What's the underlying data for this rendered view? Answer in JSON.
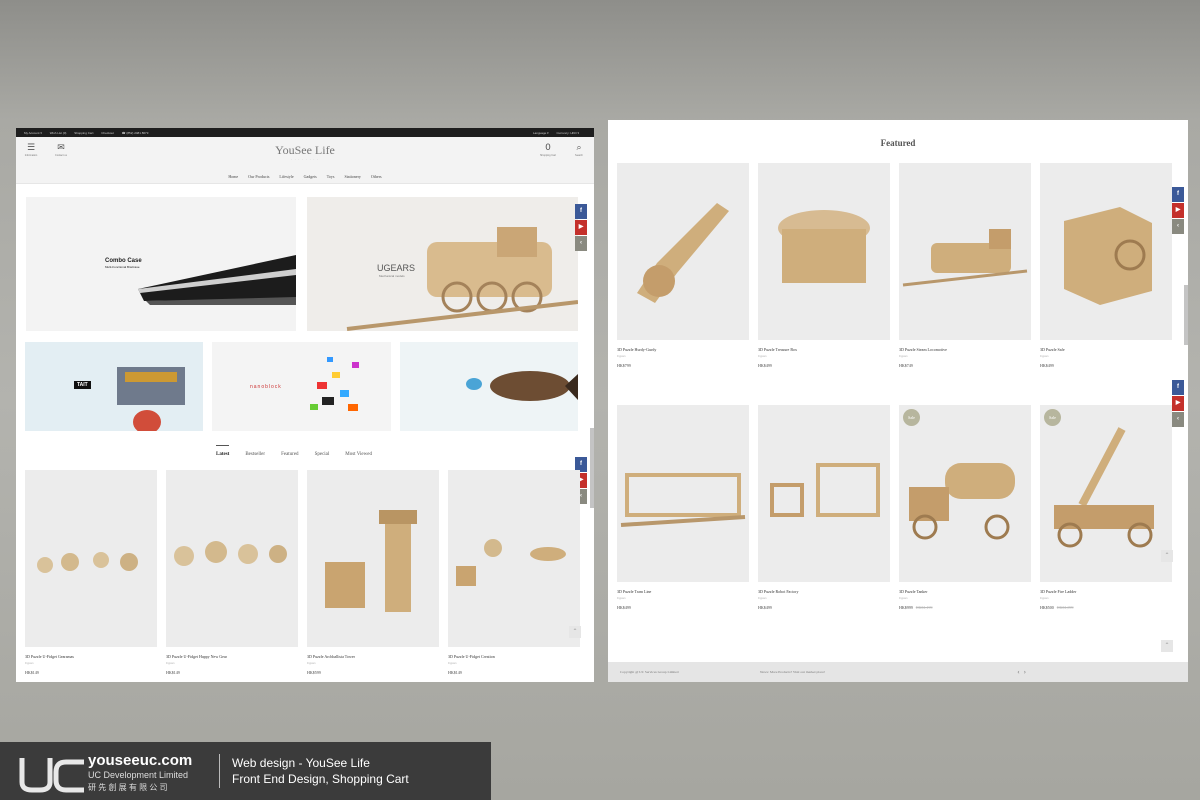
{
  "store": {
    "brand": "YouSee Life",
    "topbar_left": [
      "My Account ▾",
      "Wish List (0)",
      "Shopping Cart",
      "Checkout",
      "☎ (852) 2481 8673"
    ],
    "topbar_right": [
      "Language ▾",
      "Currency: HKD ▾"
    ],
    "header_icons": {
      "info": "Information",
      "contact": "Contact us",
      "cart": "Shopping Cart",
      "cart_count": "0",
      "search": "Search"
    },
    "nav": [
      "Home",
      "Our Products",
      "Lifestyle",
      "Gadgets",
      "Toys",
      "Stationery",
      "Others"
    ]
  },
  "banners": {
    "combo_title": "Combo Case",
    "combo_sub": "Multi-Functional Briefcase",
    "ugears": "UGEARS",
    "ugears_sub": "Mechanical models",
    "tait": "TAIT",
    "nanoblock": "nanoblock"
  },
  "tabs": [
    "Latest",
    "Bestseller",
    "Featured",
    "Special",
    "Most Viewed"
  ],
  "latest_products": [
    {
      "name": "3D Puzzle U-Fidget Gearamas",
      "brand": "Ugears",
      "price": "HK$149"
    },
    {
      "name": "3D Puzzle U-Fidget Happy New Gear",
      "brand": "Ugears",
      "price": "HK$149"
    },
    {
      "name": "3D Puzzle Archballista Tower",
      "brand": "Ugears",
      "price": "HK$599"
    },
    {
      "name": "3D Puzzle U-Fidget Creation",
      "brand": "Ugears",
      "price": "HK$149"
    }
  ],
  "featured_title": "Featured",
  "featured_products": [
    {
      "name": "3D Puzzle Hurdy-Gurdy",
      "brand": "Ugears",
      "price": "HK$799",
      "old": "",
      "sale": ""
    },
    {
      "name": "3D Puzzle Treasure Box",
      "brand": "Ugears",
      "price": "HK$499",
      "old": "",
      "sale": ""
    },
    {
      "name": "3D Puzzle Steam Locomotive",
      "brand": "Ugears",
      "price": "HK$749",
      "old": "",
      "sale": ""
    },
    {
      "name": "3D Puzzle Safe",
      "brand": "Ugears",
      "price": "HK$499",
      "old": "",
      "sale": ""
    },
    {
      "name": "3D Puzzle Tram Line",
      "brand": "Ugears",
      "price": "HK$499",
      "old": "",
      "sale": ""
    },
    {
      "name": "3D Puzzle Robot Factory",
      "brand": "Ugears",
      "price": "HK$499",
      "old": "",
      "sale": ""
    },
    {
      "name": "3D Puzzle Tanker",
      "brand": "Ugears",
      "price": "HK$999",
      "old": "HK$1,199",
      "sale": "Sale"
    },
    {
      "name": "3D Puzzle Fire Ladder",
      "brand": "Ugears",
      "price": "HK$500",
      "old": "HK$1,099",
      "sale": "Sale"
    }
  ],
  "footer": {
    "copyright": "Copyright @ UC Services Group Limited",
    "news": "News:  More Products? Visit our market place!"
  },
  "social": {
    "fb": "f",
    "yt": "▶",
    "back": "‹"
  },
  "stamp": {
    "site": "youseeuc.com",
    "company": "UC Development Limited",
    "company_cn": "研 先 創 展 有 限 公 司",
    "line1": "Web design - YouSee Life",
    "line2": "Front End Design, Shopping Cart"
  },
  "colors": {
    "accent_sale": "#b7b69e",
    "facebook": "#3b5998",
    "youtube": "#c4302b"
  }
}
